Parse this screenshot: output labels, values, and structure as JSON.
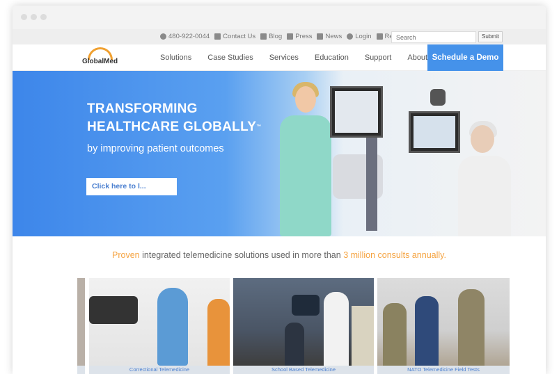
{
  "topbar": {
    "phone": "480-922-0044",
    "contact": "Contact Us",
    "blog": "Blog",
    "press": "Press",
    "news": "News",
    "login": "Login",
    "register": "Register",
    "search_placeholder": "Search",
    "submit": "Submit"
  },
  "nav": {
    "logo": "GlobalMed",
    "items": [
      "Solutions",
      "Case Studies",
      "Services",
      "Education",
      "Support",
      "About"
    ],
    "cta": "Schedule a Demo"
  },
  "hero": {
    "title_line1": "TRANSFORMING",
    "title_line2": "HEALTHCARE GLOBALLY",
    "trademark": "™",
    "subtitle": "by improving patient outcomes",
    "button": "Click here to l..."
  },
  "tagline": {
    "pre": "Proven",
    "mid": " integrated telemedicine solutions used in more than ",
    "highlight": "3 million consults annually."
  },
  "tiles": [
    {
      "caption": "Correctional Telemedicine"
    },
    {
      "caption": "School Based Telemedicine"
    },
    {
      "caption": "NATO Telemedicine Field Tests"
    }
  ]
}
